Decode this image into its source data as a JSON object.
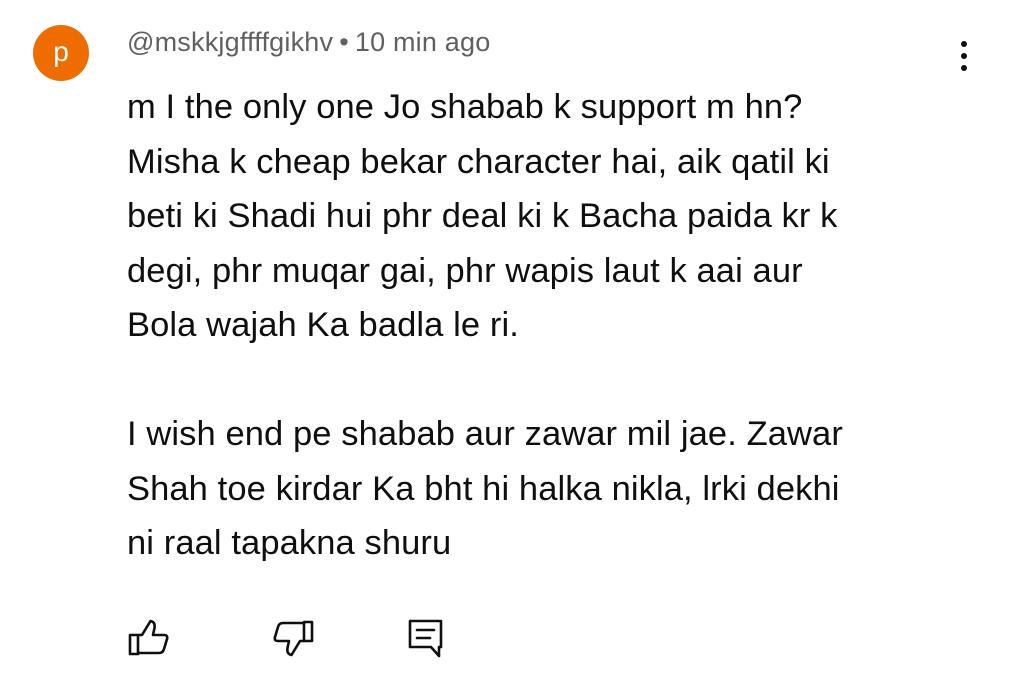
{
  "comment": {
    "avatar_letter": "p",
    "avatar_color": "#ef6c00",
    "author": "@mskkjgffffgikhv",
    "separator": "•",
    "timestamp": "10 min ago",
    "text": "m I the only one Jo shabab k support m hn?\nMisha k cheap bekar character hai, aik qatil ki\nbeti ki Shadi hui phr deal ki k Bacha paida kr k\ndegi, phr muqar gai, phr wapis laut k aai aur\nBola wajah Ka badla le ri.\n\nI wish end pe shabab aur zawar mil jae. Zawar\nShah toe kirdar Ka bht hi halka nikla, lrki dekhi\nni raal tapakna shuru"
  },
  "actions": {
    "like_icon": "thumbs-up-icon",
    "dislike_icon": "thumbs-down-icon",
    "reply_icon": "reply-icon",
    "more_icon": "more-vertical-icon"
  }
}
